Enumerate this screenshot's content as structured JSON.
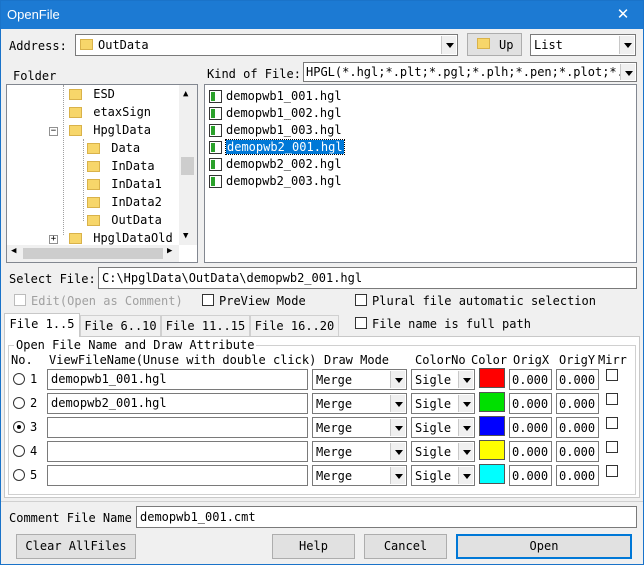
{
  "window": {
    "title": "OpenFile",
    "close_glyph": "✕"
  },
  "address": {
    "label": "Address:",
    "value": "OutData",
    "up_label": "Up",
    "view_mode": "List"
  },
  "folder_panel": {
    "label": "Folder",
    "items": [
      {
        "label": "ESD"
      },
      {
        "label": "etaxSign"
      },
      {
        "label": "HpglData"
      },
      {
        "label": "Data"
      },
      {
        "label": "InData"
      },
      {
        "label": "InData1"
      },
      {
        "label": "InData2"
      },
      {
        "label": "OutData"
      },
      {
        "label": "HpglDataOld"
      }
    ]
  },
  "kind_of_file": {
    "label": "Kind of File:",
    "value": "HPGL(*.hgl;*.plt;*.pgl;*.plh;*.pen;*.plot;*.h"
  },
  "files": [
    {
      "name": "demopwb1_001.hgl"
    },
    {
      "name": "demopwb1_002.hgl"
    },
    {
      "name": "demopwb1_003.hgl"
    },
    {
      "name": "demopwb2_001.hgl"
    },
    {
      "name": "demopwb2_002.hgl"
    },
    {
      "name": "demopwb2_003.hgl"
    }
  ],
  "select_file": {
    "label": "Select File:",
    "value": "C:\\HpglData\\OutData\\demopwb2_001.hgl"
  },
  "options": {
    "edit_label": "Edit(Open as Comment)",
    "preview_label": "PreView Mode",
    "plural_label": "Plural file automatic selection",
    "fullpath_label": "File name is full path"
  },
  "tabs": [
    {
      "label": "File 1..5"
    },
    {
      "label": "File 6..10"
    },
    {
      "label": "File 11..15"
    },
    {
      "label": "File 16..20"
    }
  ],
  "group": {
    "title": "Open File Name and Draw Attribute",
    "headers": {
      "no": "No.",
      "view_file_name": "ViewFileName(Unuse with double click)",
      "draw_mode": "Draw Mode",
      "color_no": "ColorNo",
      "color": "Color",
      "orig_x": "OrigX",
      "orig_y": "OrigY",
      "mirror": "Mirr"
    },
    "rows": [
      {
        "no": "1",
        "file": "demopwb1_001.hgl",
        "draw_mode": "Merge",
        "color_no": "Sigle",
        "color": "#ff0000",
        "orig_x": "0.000",
        "orig_y": "0.000"
      },
      {
        "no": "2",
        "file": "demopwb2_001.hgl",
        "draw_mode": "Merge",
        "color_no": "Sigle",
        "color": "#00e000",
        "orig_x": "0.000",
        "orig_y": "0.000"
      },
      {
        "no": "3",
        "file": "",
        "draw_mode": "Merge",
        "color_no": "Sigle",
        "color": "#0000ff",
        "orig_x": "0.000",
        "orig_y": "0.000"
      },
      {
        "no": "4",
        "file": "",
        "draw_mode": "Merge",
        "color_no": "Sigle",
        "color": "#ffff00",
        "orig_x": "0.000",
        "orig_y": "0.000"
      },
      {
        "no": "5",
        "file": "",
        "draw_mode": "Merge",
        "color_no": "Sigle",
        "color": "#00ffff",
        "orig_x": "0.000",
        "orig_y": "0.000"
      }
    ]
  },
  "comment": {
    "label": "Comment File Name",
    "value": "demopwb1_001.cmt"
  },
  "buttons": {
    "clear": "Clear AllFiles",
    "help": "Help",
    "cancel": "Cancel",
    "open": "Open"
  }
}
